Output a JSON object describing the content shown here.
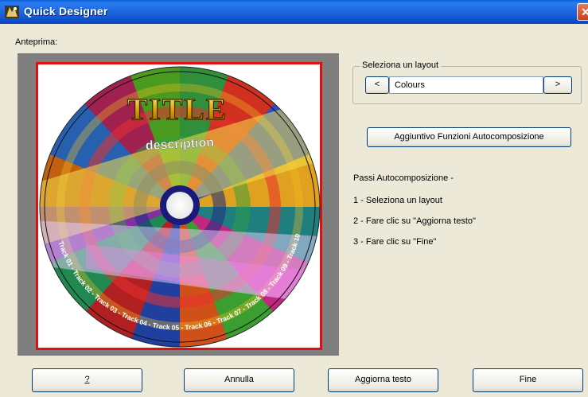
{
  "window": {
    "title": "Quick Designer",
    "close_glyph": "✕"
  },
  "preview": {
    "label": "Anteprima:",
    "cd_title": "TITLE",
    "cd_description": "description",
    "tracks": [
      "Track 01",
      "Track 02",
      "Track 03",
      "Track 04",
      "Track 05",
      "Track 06",
      "Track 07",
      "Track 08",
      "Track 09",
      "Track 10"
    ]
  },
  "layout_group": {
    "legend": "Seleziona un layout",
    "prev_glyph": "<",
    "next_glyph": ">",
    "selected": "Colours"
  },
  "wizard_button": "Aggiuntivo Funzioni Autocomposizione",
  "steps": {
    "heading": "Passi Autocomposizione -",
    "items": [
      "1 - Seleziona un layout",
      "2 - Fare clic su \"Aggiorna testo\"",
      "3 - Fare clic su \"Fine\""
    ]
  },
  "buttons": {
    "help": "?",
    "cancel": "Annulla",
    "update": "Aggiorna testo",
    "finish": "Fine"
  }
}
